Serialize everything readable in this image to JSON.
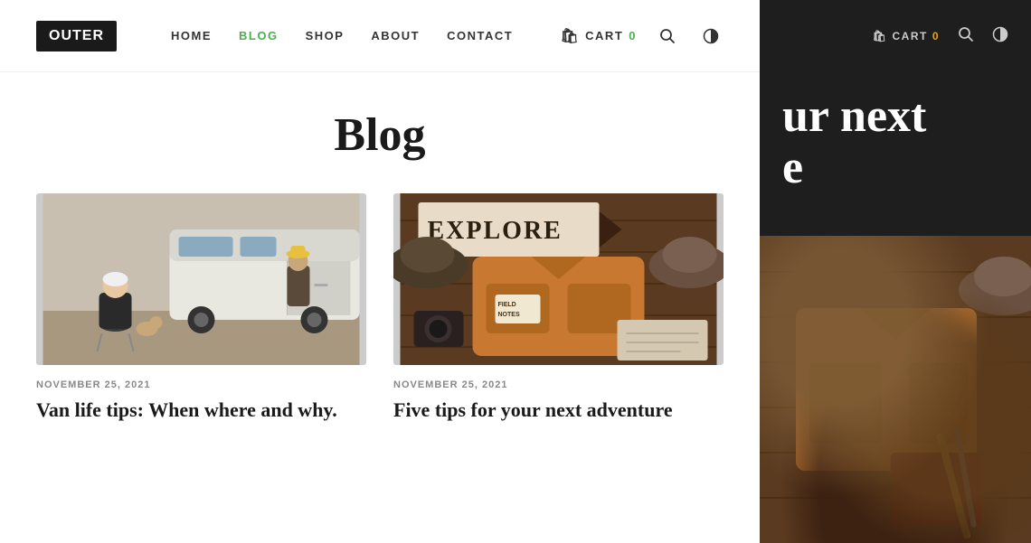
{
  "logo": {
    "text": "OUTER"
  },
  "nav": {
    "items": [
      {
        "label": "HOME",
        "active": false
      },
      {
        "label": "BLOG",
        "active": true
      },
      {
        "label": "SHOP",
        "active": false
      },
      {
        "label": "ABOUT",
        "active": false
      },
      {
        "label": "CONTACT",
        "active": false
      }
    ]
  },
  "header": {
    "cart_label": "CART",
    "cart_count": "0",
    "search_icon": "🔍",
    "contrast_icon": "◑"
  },
  "right_panel": {
    "cart_label": "CART",
    "cart_count": "0",
    "headline_line1": "ur next",
    "headline_line2": "e"
  },
  "blog": {
    "title": "Blog",
    "posts": [
      {
        "date": "NOVEMBER 25, 2021",
        "title": "Van life tips: When where and why.",
        "image_type": "van"
      },
      {
        "date": "NOVEMBER 25, 2021",
        "title": "Five tips for your next adventure",
        "image_type": "explore"
      }
    ]
  }
}
